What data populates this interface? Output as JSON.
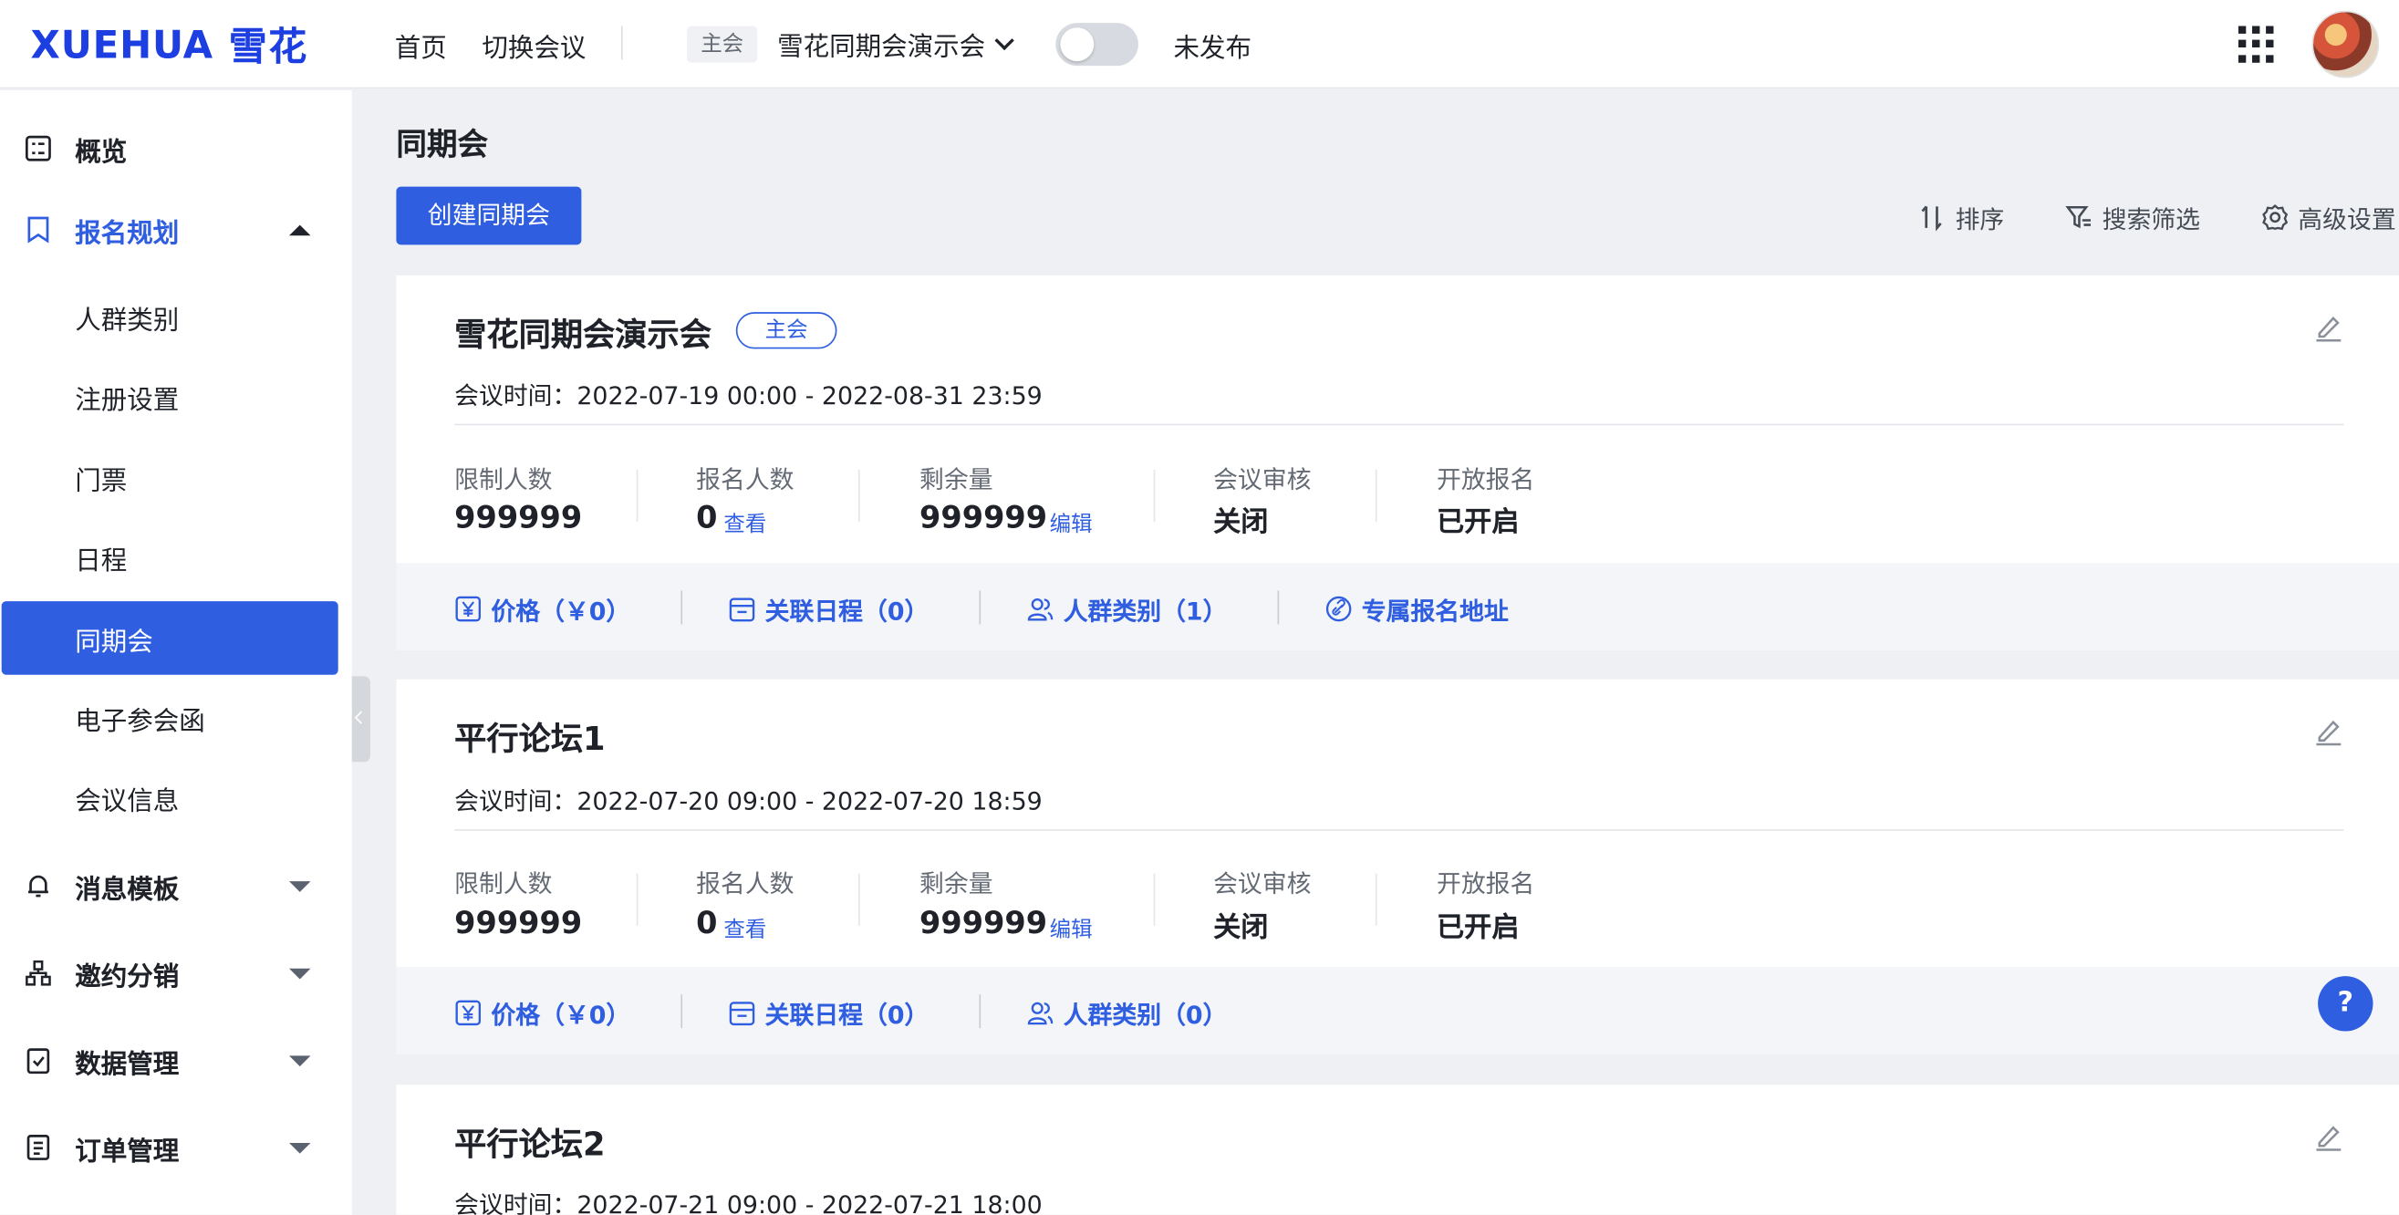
{
  "brand": {
    "latin": "XUEHUA",
    "cn": "雪花"
  },
  "topnav": {
    "home": "首页",
    "switch": "切换会议",
    "main_tag": "主会",
    "meeting_name": "雪花同期会演示会",
    "publish_status": "未发布"
  },
  "sidebar": {
    "overview": "概览",
    "signup_plan": "报名规划",
    "sub_items": [
      "人群类别",
      "注册设置",
      "门票",
      "日程",
      "同期会",
      "电子参会函",
      "会议信息"
    ],
    "message_template": "消息模板",
    "invite": "邀约分销",
    "data_mgmt": "数据管理",
    "order_mgmt": "订单管理"
  },
  "main": {
    "page_title": "同期会",
    "create_button": "创建同期会",
    "tools": {
      "sort": "排序",
      "filter": "搜索筛选",
      "advanced": "高级设置"
    }
  },
  "cards": [
    {
      "title": "雪花同期会演示会",
      "badge": "主会",
      "time": "会议时间：2022-07-19 00:00 - 2022-08-31 23:59",
      "stats": {
        "limit_label": "限制人数",
        "limit_value": "999999",
        "signup_label": "报名人数",
        "signup_value": "0",
        "signup_link": "查看",
        "remain_label": "剩余量",
        "remain_value": "999999",
        "remain_link": "编辑",
        "review_label": "会议审核",
        "review_value": "关闭",
        "open_label": "开放报名",
        "open_value": "已开启"
      },
      "footer": {
        "price": "价格（￥0）",
        "schedule": "关联日程（0）",
        "groups": "人群类别（1）",
        "url": "专属报名地址"
      }
    },
    {
      "title": "平行论坛1",
      "time": "会议时间：2022-07-20 09:00 - 2022-07-20 18:59",
      "stats": {
        "limit_label": "限制人数",
        "limit_value": "999999",
        "signup_label": "报名人数",
        "signup_value": "0",
        "signup_link": "查看",
        "remain_label": "剩余量",
        "remain_value": "999999",
        "remain_link": "编辑",
        "review_label": "会议审核",
        "review_value": "关闭",
        "open_label": "开放报名",
        "open_value": "已开启"
      },
      "footer": {
        "price": "价格（￥0）",
        "schedule": "关联日程（0）",
        "groups": "人群类别（0）"
      }
    },
    {
      "title": "平行论坛2",
      "time": "会议时间：2022-07-21 09:00 - 2022-07-21 18:00"
    }
  ],
  "help": "?",
  "colors": {
    "accent": "#2f5ee0",
    "brand": "#1d3ee0",
    "background": "#eef0f3"
  }
}
